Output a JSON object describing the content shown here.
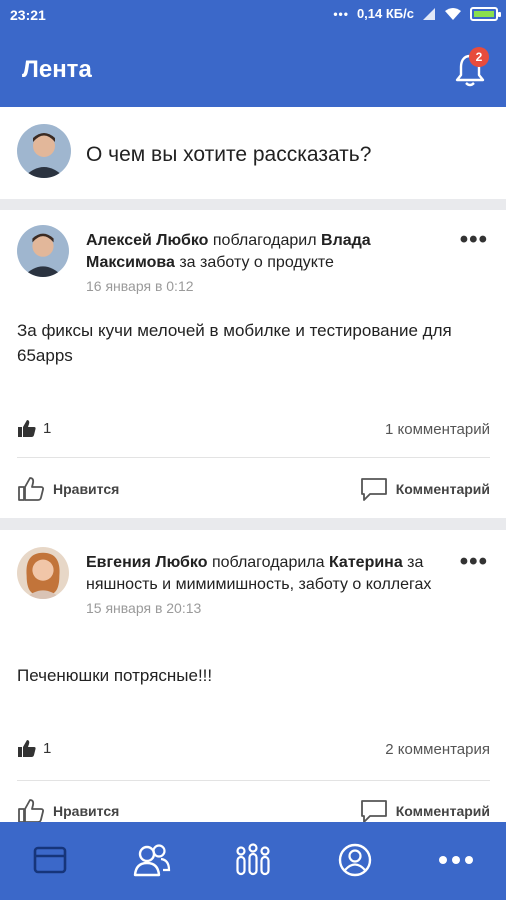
{
  "status_bar": {
    "time": "23:21",
    "signal_dots": "•••",
    "speed": "0,14 КБ/с"
  },
  "app_bar": {
    "title": "Лента",
    "notification_count": "2"
  },
  "compose": {
    "prompt": "О чем вы хотите рассказать?"
  },
  "posts": [
    {
      "author": "Алексей Любко",
      "verb": "поблагодарил",
      "recipient": "Влада Максимова",
      "reason": "за заботу о продукте",
      "date": "16 января в 0:12",
      "text": "За фиксы кучи мелочей в мобилке и тестирование для 65apps",
      "likes": "1",
      "comments": "1 комментарий",
      "like_label": "Нравится",
      "comment_label": "Комментарий"
    },
    {
      "author": "Евгения Любко",
      "verb": "поблагодарила",
      "recipient": "Катерина",
      "reason": " за няшность и мимимишность, заботу о коллегах",
      "date": "15 января в 20:13",
      "text": "Печенюшки потрясные!!!",
      "likes": "1",
      "comments": "2 комментария",
      "like_label": "Нравится",
      "comment_label": "Комментарий"
    }
  ],
  "bottom_nav": {
    "items": [
      {
        "icon": "feed-icon"
      },
      {
        "icon": "people-icon"
      },
      {
        "icon": "teams-icon"
      },
      {
        "icon": "profile-icon"
      },
      {
        "icon": "more-icon"
      }
    ]
  },
  "colors": {
    "primary": "#3b68c9",
    "badge": "#e74c3c",
    "background": "#e9eaed"
  }
}
